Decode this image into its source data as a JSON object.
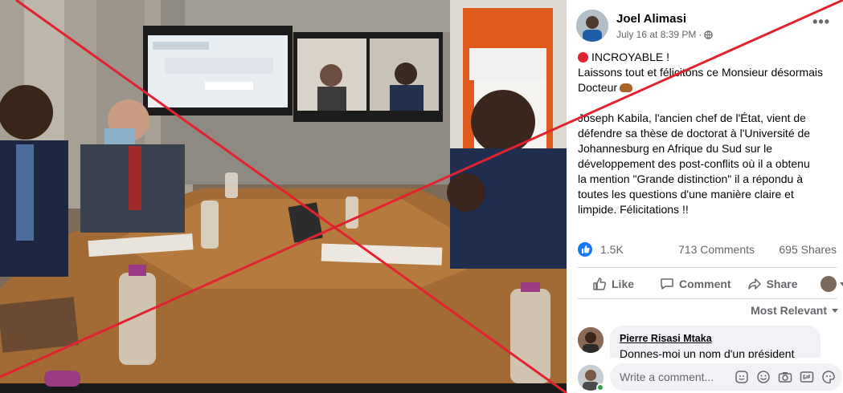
{
  "post": {
    "author": "Joel Alimasi",
    "date": "July 16 at 8:39 PM",
    "separator": "·",
    "more_glyph": "•••",
    "text": {
      "headline": "INCROYABLE !",
      "line2": "Laissons tout et félicitons ce Monsieur désormais",
      "line3": "Docteur",
      "body": [
        "Joseph Kabila, l'ancien chef de l'État, vient de",
        "défendre sa thèse de doctorat à l'Université de",
        "Johannesburg en Afrique du Sud sur le",
        "développement des post-conflits où il a obtenu",
        "la mention \"Grande distinction\" il a répondu à",
        "toutes les questions d'une manière claire et",
        "limpide. Félicitations !!"
      ]
    },
    "stats": {
      "likes": "1.5K",
      "comments": "713 Comments",
      "shares": "695 Shares"
    },
    "actions": {
      "like": "Like",
      "comment": "Comment",
      "share": "Share"
    },
    "sort_label": "Most Relevant"
  },
  "comment": {
    "author": "Pierre Risasi Mtaka",
    "text": "Donnes-moi un nom d'un président"
  },
  "composer": {
    "placeholder": "Write a comment..."
  },
  "colors": {
    "like_blue": "#1877f2",
    "overlay_red": "#e0232f",
    "online_green": "#31a24c",
    "secondary_text": "#65676b"
  },
  "icons": [
    "privacy-globe-icon",
    "red-circle-emoji-icon",
    "bread-emoji-icon",
    "like-reaction-icon",
    "thumbs-up-icon",
    "comment-icon",
    "share-icon",
    "chevron-down-icon",
    "sticker-icon",
    "emoji-icon",
    "camera-icon",
    "gif-icon",
    "sticker-smile-icon"
  ]
}
